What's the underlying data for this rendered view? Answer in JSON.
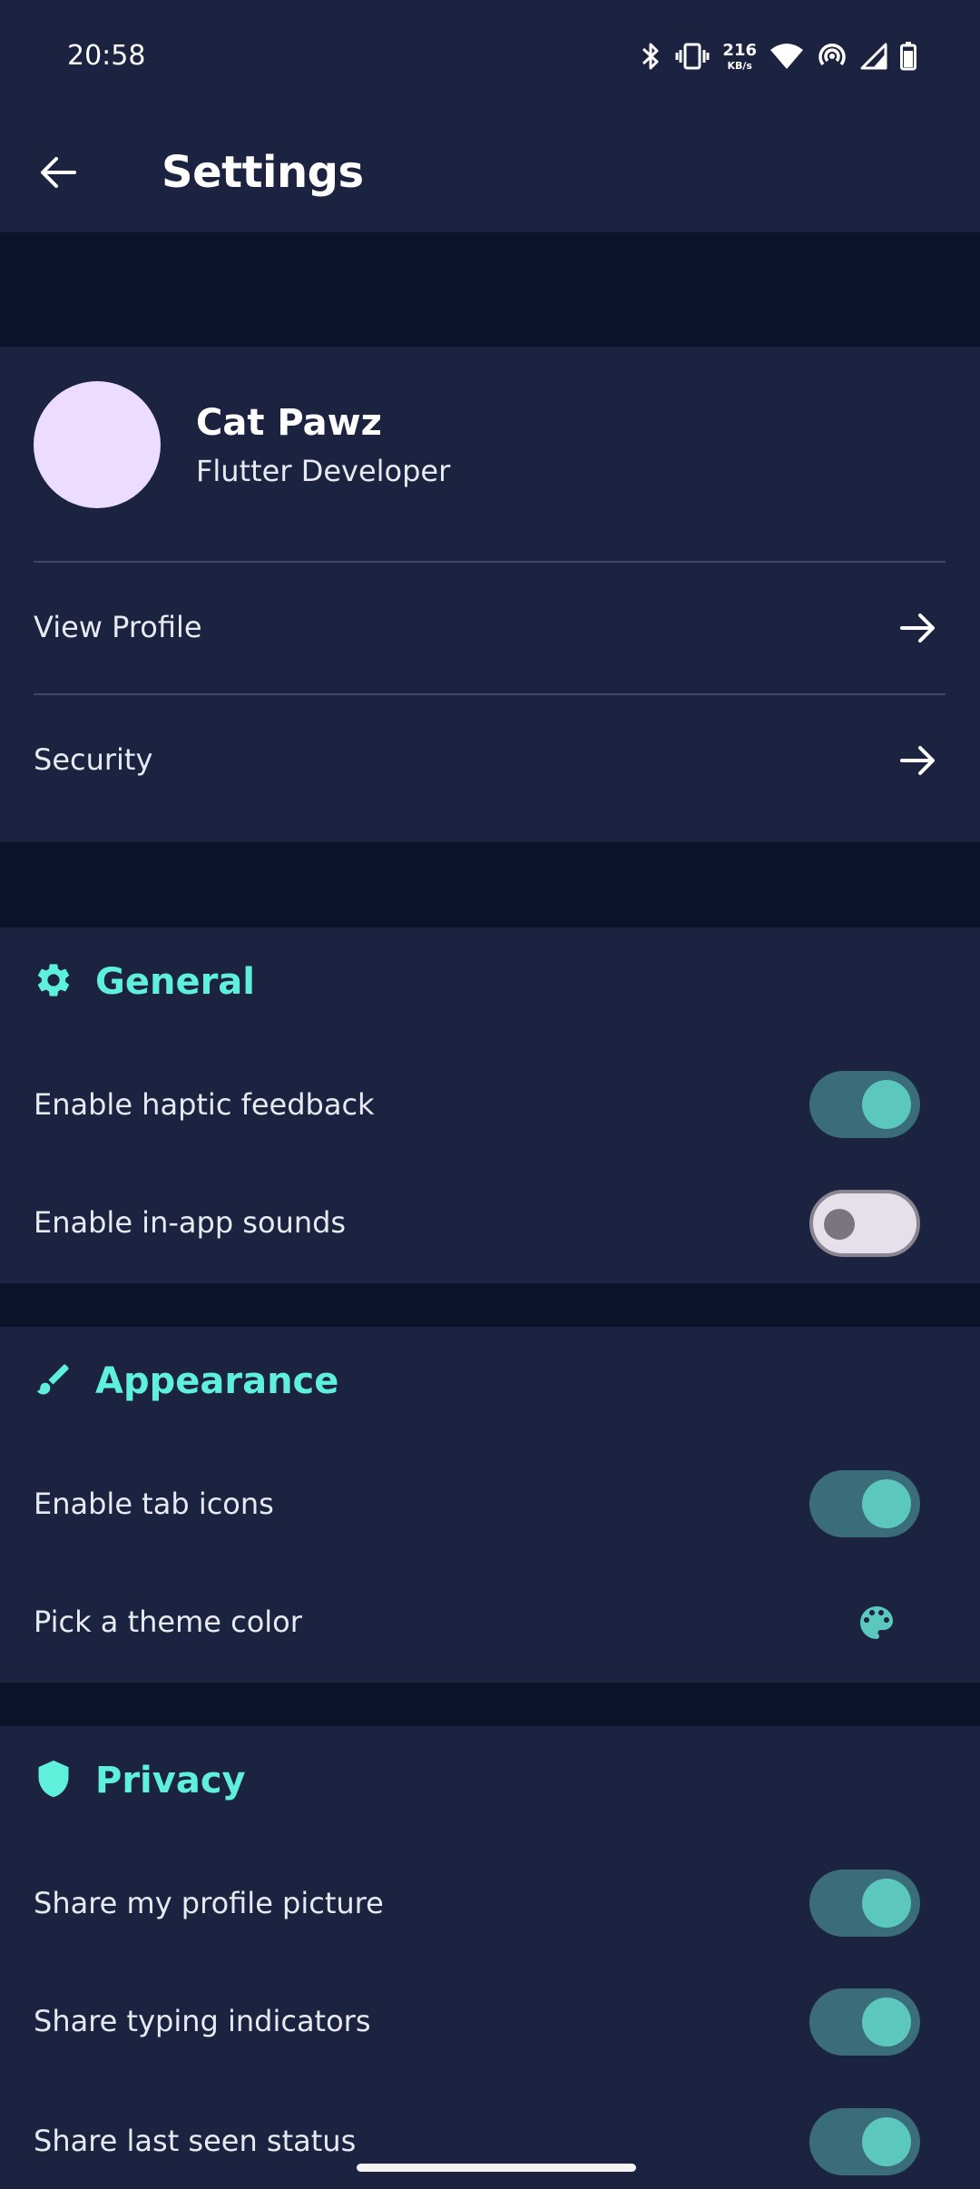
{
  "status_bar": {
    "time": "20:58",
    "net_speed_value": "216",
    "net_speed_unit": "KB/s",
    "icons": [
      "bluetooth-icon",
      "vibrate-icon",
      "wifi-icon",
      "hotspot-icon",
      "cell-signal-icon",
      "battery-icon"
    ]
  },
  "app_bar": {
    "title": "Settings",
    "back_icon": "arrow-back-icon"
  },
  "profile": {
    "name": "Cat Pawz",
    "role": "Flutter Developer",
    "avatar_color": "#ecdcff",
    "items": [
      {
        "label": "View Profile",
        "icon": "arrow-forward-icon"
      },
      {
        "label": "Security",
        "icon": "arrow-forward-icon"
      }
    ]
  },
  "sections": {
    "general": {
      "title": "General",
      "icon": "gear-icon",
      "items": [
        {
          "label": "Enable haptic feedback",
          "enabled": true
        },
        {
          "label": "Enable in-app sounds",
          "enabled": false
        }
      ]
    },
    "appearance": {
      "title": "Appearance",
      "icon": "brush-icon",
      "items": [
        {
          "label": "Enable tab icons",
          "enabled": true
        },
        {
          "label": "Pick a theme color",
          "icon": "palette-icon"
        }
      ]
    },
    "privacy": {
      "title": "Privacy",
      "icon": "shield-icon",
      "items": [
        {
          "label": "Share my profile picture",
          "enabled": true
        },
        {
          "label": "Share typing indicators",
          "enabled": true
        },
        {
          "label": "Share last seen status",
          "enabled": true
        }
      ]
    }
  },
  "colors": {
    "background": "#1c2340",
    "section_gap": "#0b132b",
    "accent": "#5ff0dc",
    "toggle_on_track": "#3a6c79",
    "toggle_on_thumb": "#5cc8bd",
    "toggle_off_track": "#e6e0ea"
  }
}
